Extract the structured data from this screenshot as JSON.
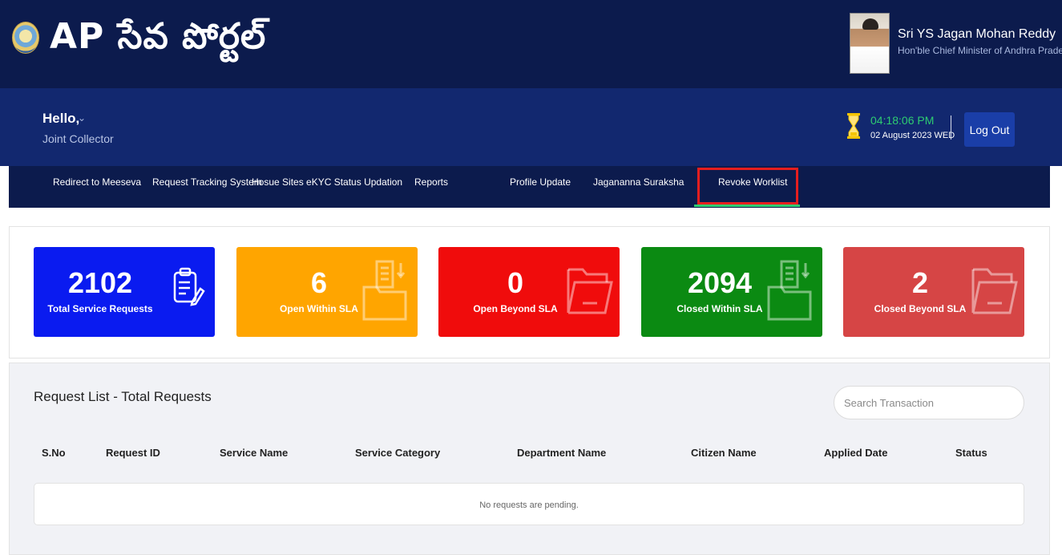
{
  "header": {
    "logo_text": "AP సేవ పోర్టల్",
    "cm_name": "Sri YS Jagan Mohan Reddy",
    "cm_title": "Hon'ble Chief Minister of Andhra Pradesh"
  },
  "user": {
    "greeting": "Hello,",
    "role": "Joint Collector"
  },
  "clock": {
    "time": "04:18:06 PM",
    "date": "02 August 2023 WED"
  },
  "logout_label": "Log Out",
  "nav": {
    "items": [
      {
        "label": "Redirect to Meeseva"
      },
      {
        "label": "Request Tracking System"
      },
      {
        "label": "Hosue Sites eKYC Status Updation"
      },
      {
        "label": "Reports"
      },
      {
        "label": "Profile Update"
      },
      {
        "label": "Jagananna Suraksha"
      },
      {
        "label": "Revoke Worklist"
      }
    ],
    "active": "Revoke Worklist"
  },
  "stats": [
    {
      "value": "2102",
      "label": "Total Service Requests",
      "color": "#0a1bf0",
      "icon": "clipboard-icon"
    },
    {
      "value": "6",
      "label": "Open Within SLA",
      "color": "#ffa500",
      "icon": "documents-folder-icon"
    },
    {
      "value": "0",
      "label": "Open Beyond SLA",
      "color": "#f00c0c",
      "icon": "folder-icon"
    },
    {
      "value": "2094",
      "label": "Closed Within SLA",
      "color": "#0b8a12",
      "icon": "documents-folder-icon"
    },
    {
      "value": "2",
      "label": "Closed Beyond SLA",
      "color": "#d64545",
      "icon": "folder-icon"
    }
  ],
  "request_list": {
    "title": "Request List - Total Requests",
    "search_placeholder": "Search Transaction",
    "columns": [
      "S.No",
      "Request ID",
      "Service Name",
      "Service Category",
      "Department Name",
      "Citizen Name",
      "Applied Date",
      "Status"
    ],
    "empty_message": "No requests are pending."
  }
}
